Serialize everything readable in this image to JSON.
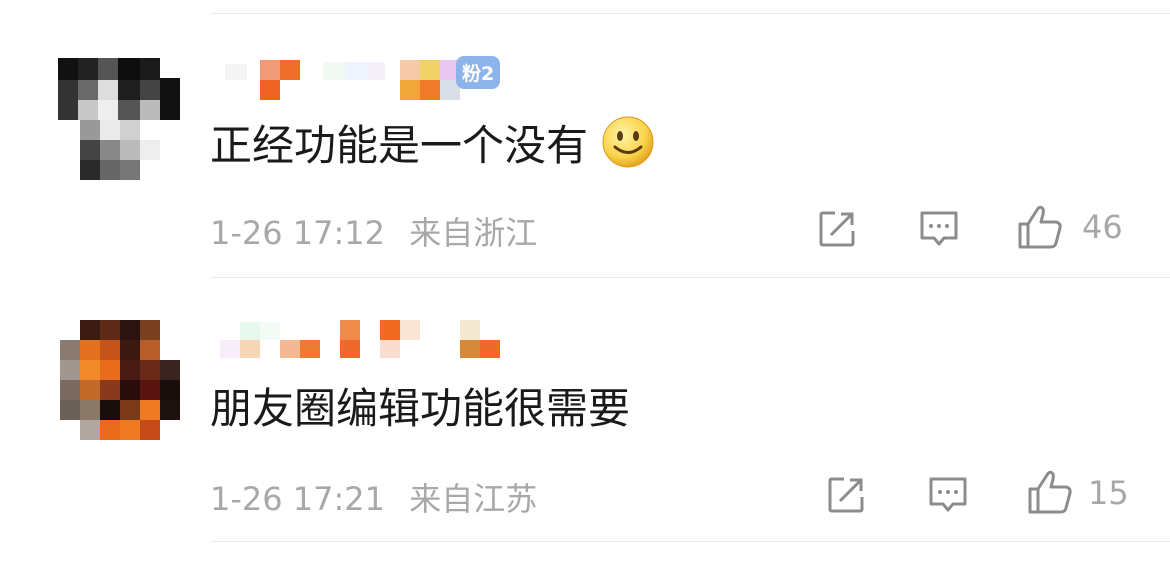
{
  "comments": [
    {
      "fan_badge": "粉2",
      "text": "正经功能是一个没有",
      "has_emoji": true,
      "emoji": "smile-emoji",
      "time": "1-26 17:12",
      "location": "来自浙江",
      "likes": "46"
    },
    {
      "text": "朋友圈编辑功能很需要",
      "has_emoji": false,
      "time": "1-26 17:21",
      "location": "来自江苏",
      "likes": "15"
    }
  ],
  "colors": {
    "text": "#1a1a1a",
    "meta": "#a8a8a8",
    "badge": "#8db4ea",
    "divider": "#ececec"
  },
  "icons": [
    "share-icon",
    "reply-icon",
    "like-icon"
  ]
}
